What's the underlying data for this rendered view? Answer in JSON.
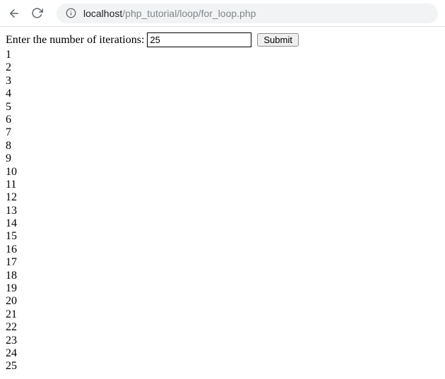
{
  "browser": {
    "url_host": "localhost",
    "url_path": "/php_tutorial/loop/for_loop.php"
  },
  "form": {
    "label": "Enter the number of iterations: ",
    "input_value": "25",
    "submit_label": "Submit"
  },
  "output": {
    "lines": [
      "1",
      "2",
      "3",
      "4",
      "5",
      "6",
      "7",
      "8",
      "9",
      "10",
      "11",
      "12",
      "13",
      "14",
      "15",
      "16",
      "17",
      "18",
      "19",
      "20",
      "21",
      "22",
      "23",
      "24",
      "25"
    ]
  }
}
